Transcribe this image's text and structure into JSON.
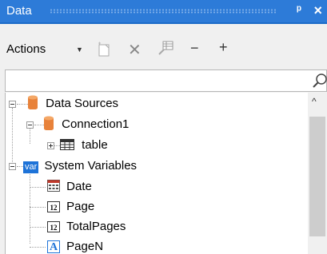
{
  "panel": {
    "title": "Data"
  },
  "toolbar": {
    "actions_label": "Actions",
    "minus_label": "−",
    "plus_label": "+"
  },
  "search": {
    "value": "",
    "placeholder": ""
  },
  "tree": {
    "data_sources": "Data Sources",
    "connection": "Connection1",
    "table": "table",
    "system_variables": "System Variables",
    "var_badge": "var",
    "vars": [
      "Date",
      "Page",
      "TotalPages",
      "PageN"
    ],
    "num_badge": "12",
    "text_badge": "A"
  },
  "colors": {
    "titlebar": "#2d7bd8",
    "db_orange": "#e8823a",
    "var_blue": "#1e73d8"
  }
}
